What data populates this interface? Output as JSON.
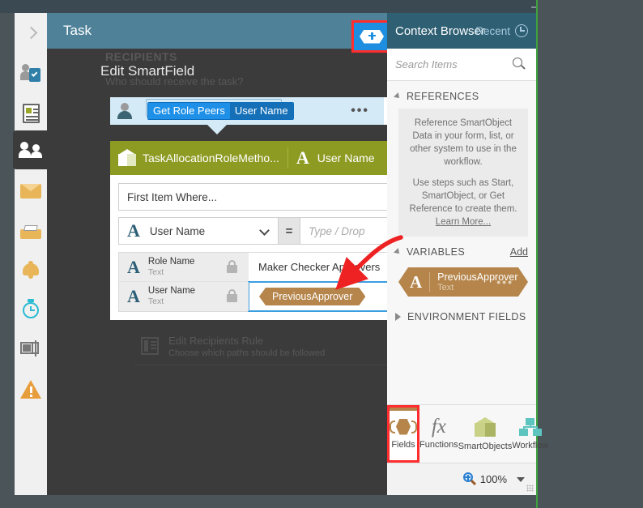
{
  "top_bar": {
    "icons": [
      "corner-icon-1",
      "corner-icon-2",
      "menu-icon"
    ]
  },
  "rail": {
    "items": [
      {
        "name": "expand-panel",
        "icon": "chevron-right-icon",
        "selected": false
      },
      {
        "name": "task-step",
        "icon": "person-clipboard-icon",
        "selected": false
      },
      {
        "name": "form-step",
        "icon": "document-icon",
        "selected": false
      },
      {
        "name": "users-step",
        "icon": "people-icon",
        "selected": true
      },
      {
        "name": "mail-step",
        "icon": "envelope-icon",
        "selected": false
      },
      {
        "name": "inbox-step",
        "icon": "inbox-icon",
        "selected": false
      },
      {
        "name": "notify-step",
        "icon": "bell-icon",
        "selected": false
      },
      {
        "name": "timer-step",
        "icon": "timer-icon",
        "selected": false
      },
      {
        "name": "form-control-step",
        "icon": "form-icon",
        "selected": false
      },
      {
        "name": "error-step",
        "icon": "warning-icon",
        "selected": false
      }
    ]
  },
  "canvas": {
    "header_title": "Task",
    "context_toggle_icon": "hex-eye-plus-icon",
    "background": {
      "section_label": "RECIPIENTS",
      "question": "Who should receive the task?",
      "rule_title": "Edit Recipients Rule",
      "rule_subtitle": "Choose which paths should be followed"
    }
  },
  "dialog": {
    "title": "Edit SmartField",
    "close_icon": "close-icon",
    "recipient_chip": {
      "avatar_icon": "avatar-icon",
      "part_a": "Get Role Peers",
      "part_b": "User Name",
      "more_icon": "ellipsis-icon",
      "edit_icon": "pencil-icon"
    },
    "smartobject": {
      "cube_icon": "cube-icon",
      "name": "TaskAllocationRoleMetho...",
      "type_glyph": "A",
      "field": "User Name",
      "more_icon": "ellipsis-icon"
    },
    "method_select": {
      "value": "First Item Where...",
      "caret_icon": "chevron-down-icon"
    },
    "criteria": {
      "type_glyph": "A",
      "property": "User Name",
      "caret_icon": "chevron-down-icon",
      "operator": "=",
      "value_placeholder": "Type / Drop"
    },
    "return_rows": [
      {
        "glyph": "A",
        "name": "Role Name",
        "type": "Text",
        "lock_icon": "lock-icon",
        "value": "Maker Checker Approvers",
        "value_is_chip": false,
        "focused": false
      },
      {
        "glyph": "A",
        "name": "User Name",
        "type": "Text",
        "lock_icon": "lock-icon",
        "value": "PreviousApprover",
        "value_is_chip": true,
        "focused": true
      }
    ]
  },
  "context_browser": {
    "title": "Context Browser",
    "recent_label": "Recent",
    "recent_icon": "clock-icon",
    "search_placeholder": "Search Items",
    "search_icon": "magnifier-icon",
    "sections": {
      "references": {
        "label": "REFERENCES",
        "expanded": true,
        "note_line_1": "Reference SmartObject Data in your form, list, or other system to use in the workflow.",
        "note_line_2": "Use steps such as Start, SmartObject, or Get Reference to create them.",
        "note_link": "Learn More..."
      },
      "variables": {
        "label": "VARIABLES",
        "expanded": true,
        "add_label": "Add",
        "items": [
          {
            "glyph": "A",
            "name": "PreviousApprover",
            "type": "Text",
            "more_icon": "ellipsis-icon"
          }
        ]
      },
      "environment_fields": {
        "label": "ENVIRONMENT FIELDS",
        "expanded": false
      }
    },
    "tabs": [
      {
        "label": "Fields",
        "icon": "fields-hex-icon",
        "active": true
      },
      {
        "label": "Functions",
        "icon": "fx-icon",
        "active": false
      },
      {
        "label": "SmartObjects",
        "icon": "cube-icon",
        "active": false
      },
      {
        "label": "Workflow",
        "icon": "workflow-icon",
        "active": false
      }
    ],
    "status": {
      "zoom_icon": "zoom-icon",
      "zoom_level": "100%",
      "dropdown_icon": "caret-down-icon",
      "resize_grip": "grip-icon"
    }
  },
  "annotations": {
    "highlight_color": "#ff2d2d",
    "arrow_color": "#ee2222",
    "arrow_from": "variables PreviousApprover chip",
    "arrow_to": "User Name return value field"
  }
}
